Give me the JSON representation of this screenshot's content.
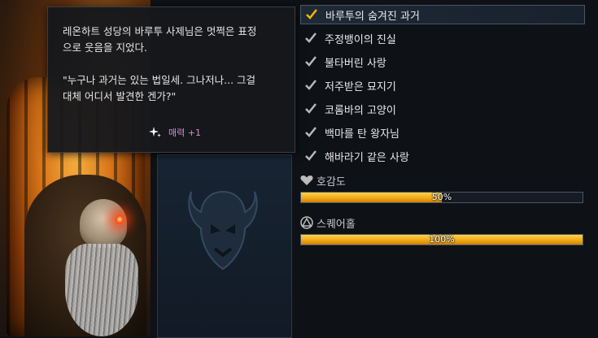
{
  "window": {
    "title": ""
  },
  "tooltip": {
    "line1": "레온하트 성당의 바루투 사제님은 멋쩍은 표정\n으로 웃음을 지었다.",
    "line2": "\"누구나 과거는 있는 법일세. 그나저나... 그걸\n대체 어디서 발견한 겐가?\"",
    "reward": "매력 +1"
  },
  "quests": [
    {
      "label": "바루투의 숨겨진 과거",
      "active": true
    },
    {
      "label": "주정뱅이의 진실",
      "active": false
    },
    {
      "label": "불타버린 사랑",
      "active": false
    },
    {
      "label": "저주받은 묘지기",
      "active": false
    },
    {
      "label": "코롬바의 고양이",
      "active": false
    },
    {
      "label": "백마를 탄 왕자님",
      "active": false
    },
    {
      "label": "해바라기 같은 사랑",
      "active": false
    }
  ],
  "rapport": {
    "label": "호감도",
    "percent_text": "50%",
    "value": 0.5
  },
  "square_hole": {
    "label": "스퀘어홀",
    "percent_text": "100%",
    "value": 1.0
  },
  "colors": {
    "accent_gold": "#f3a916",
    "check_active": "#f5b800",
    "check_inactive": "#b8b8b8",
    "reward": "#d58ad6"
  }
}
